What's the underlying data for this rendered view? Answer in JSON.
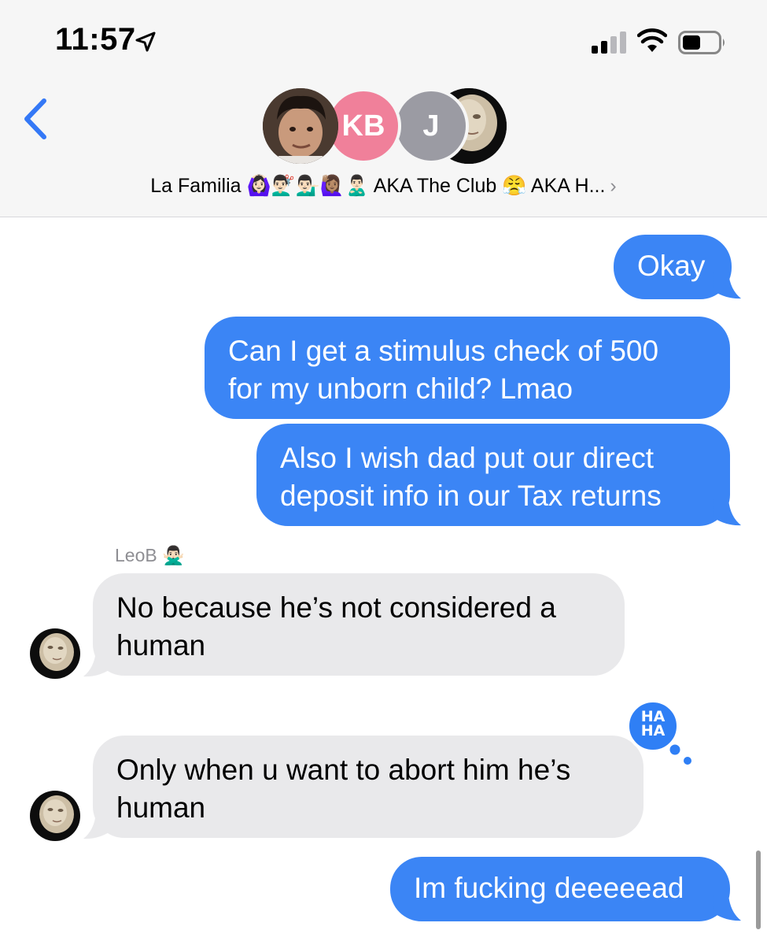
{
  "status_bar": {
    "time": "11:57",
    "icons": [
      "location-arrow-icon",
      "signal-icon",
      "wifi-icon",
      "battery-icon"
    ]
  },
  "header": {
    "back_icon": "chevron-left-icon",
    "avatars": [
      {
        "type": "photo"
      },
      {
        "type": "initials",
        "text": "KB",
        "color": "#f0809a"
      },
      {
        "type": "initials",
        "text": "J",
        "color": "#9b9ba3"
      },
      {
        "type": "photo"
      }
    ],
    "group_name": "La Familia 🙆🏻‍♀️💇🏻‍♂️💁🏻‍♂️🙋🏽‍♀️🙎🏻‍♂️ AKA The Club 😤 AKA H...",
    "chevron": "›"
  },
  "messages": [
    {
      "direction": "outgoing",
      "lines": [
        "Okay"
      ]
    },
    {
      "direction": "outgoing",
      "lines": [
        "Can I get a stimulus check of 500",
        "for my unborn child? Lmao"
      ]
    },
    {
      "direction": "outgoing",
      "lines": [
        "Also I wish dad put our direct",
        "deposit info in our Tax returns"
      ]
    },
    {
      "direction": "incoming",
      "sender": "LeoB 🙅🏻‍♂️",
      "lines": [
        "No because he’s not considered a",
        "human"
      ]
    },
    {
      "direction": "incoming",
      "lines": [
        "Only when u want to abort him he’s",
        "human"
      ],
      "tapback": "HA HA"
    },
    {
      "direction": "outgoing",
      "lines": [
        "Im fucking deeeeead"
      ]
    }
  ],
  "colors": {
    "outgoing_bubble": "#3b85f5",
    "incoming_bubble": "#e9e9eb",
    "ios_blue": "#3478f6",
    "header_bg": "#f6f6f6"
  }
}
